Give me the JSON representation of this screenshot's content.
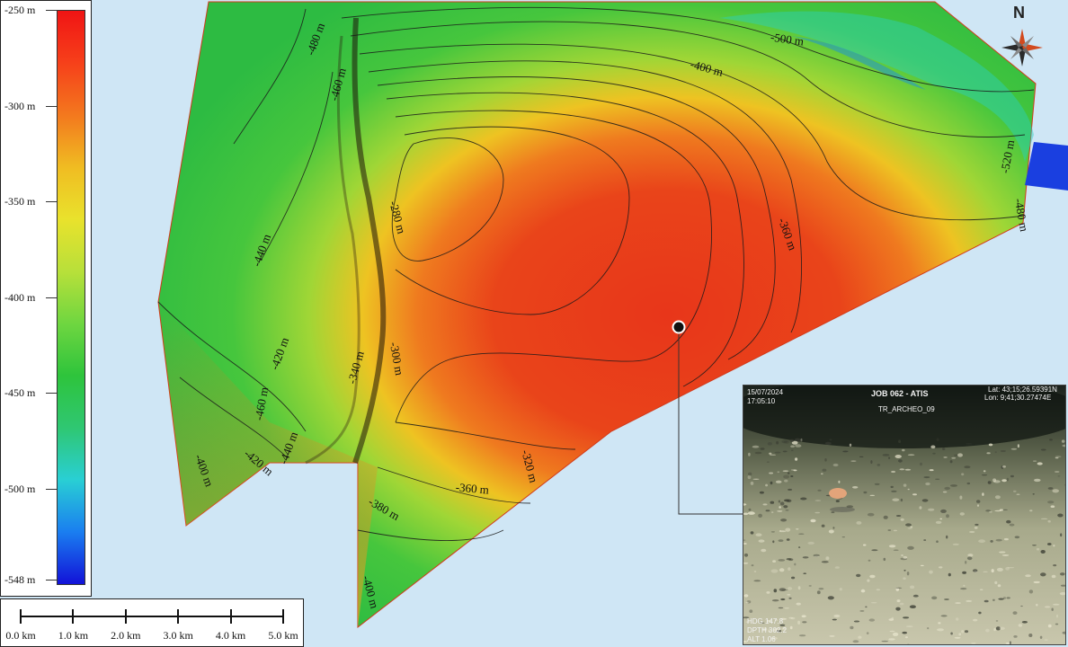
{
  "legend": {
    "labels": [
      "-250 m",
      "-300 m",
      "-350 m",
      "-400 m",
      "-450 m",
      "-500 m",
      "-548 m"
    ],
    "gradient_colors": [
      "#f01414",
      "#f6401a",
      "#f3781e",
      "#f0bc22",
      "#e9e22c",
      "#b8e03a",
      "#6fd640",
      "#2ec43c",
      "#2fc772",
      "#29cfd4",
      "#1a7ef0",
      "#1212d8"
    ]
  },
  "scale_bar": {
    "labels": [
      "0.0 km",
      "1.0 km",
      "2.0 km",
      "3.0 km",
      "4.0 km",
      "5.0 km"
    ]
  },
  "compass": {
    "north_label": "N"
  },
  "contour_labels": [
    "-480 m",
    "-460 m",
    "-500 m",
    "-400 m",
    "-520 m",
    "-480 m",
    "-280 m",
    "-440 m",
    "-360 m",
    "-420 m",
    "-340 m",
    "-300 m",
    "-460 m",
    "-440 m",
    "-400 m",
    "-420 m",
    "-320 m",
    "-360 m",
    "-380 m",
    "-400 m"
  ],
  "photo_inset": {
    "date": "15/07/2024",
    "time": "17:05:10",
    "job": "JOB 062 - ATIS",
    "lat": "Lat: 43;15;26.59391N",
    "lon": "Lon: 9;41;30.27474E",
    "site": "TR_ARCHEO_09",
    "hdg": "HDG 147.8",
    "dpt": "DPTH 302.2",
    "alt": "ALT 1.06"
  },
  "colors": {
    "sea": "#cfe6f5",
    "shallow": "#e8301a",
    "deep": "#1a3fe0",
    "mid": "#36c43c"
  }
}
